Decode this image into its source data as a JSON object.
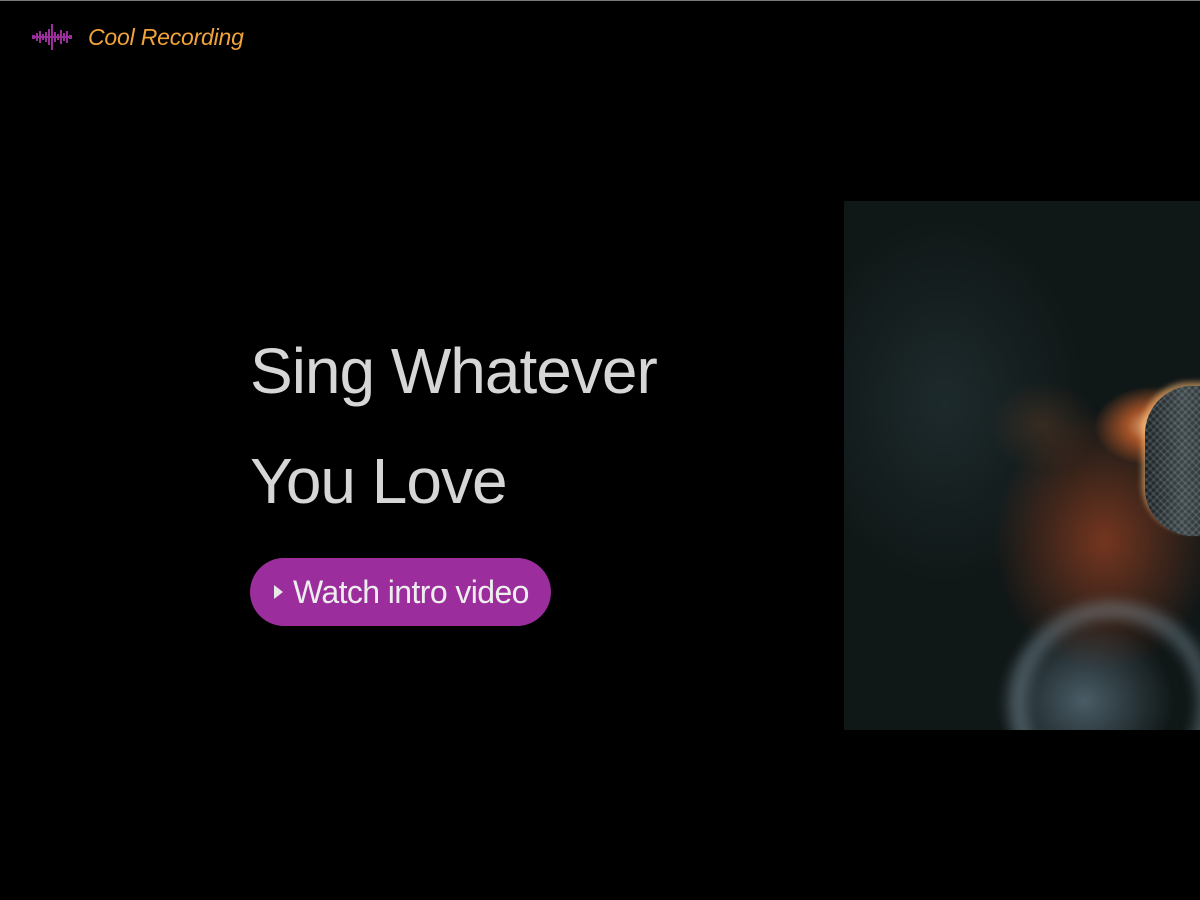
{
  "brand": {
    "name": "Cool Recording",
    "icon": "waveform-icon",
    "colors": {
      "text": "#f0a43a",
      "icon": "#9b2e9c"
    }
  },
  "hero": {
    "title_line1": "Sing Whatever",
    "title_line2": "You Love",
    "cta_label": "Watch intro video",
    "cta_icon": "play-icon",
    "accent": "#9b2e9c"
  },
  "photo": {
    "subject": "microphone"
  }
}
